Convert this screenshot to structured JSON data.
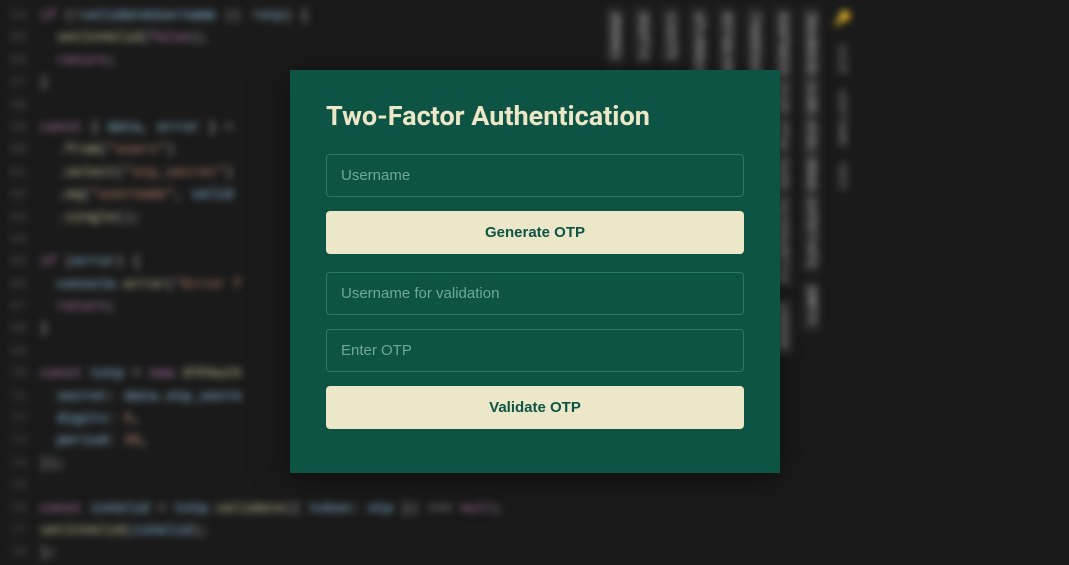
{
  "dialog": {
    "title": "Two-Factor Authentication",
    "username_placeholder": "Username",
    "generate_btn": "Generate OTP",
    "validation_username_placeholder": "Username for validation",
    "otp_placeholder": "Enter OTP",
    "validate_btn": "Validate OTP"
  },
  "code": {
    "lines": [
      {
        "num": "54",
        "text": "if (!validateUsername || !otp) {"
      },
      {
        "num": "55",
        "text": "  setIsValid(false);"
      },
      {
        "num": "56",
        "text": "  return;"
      },
      {
        "num": "57",
        "text": "}"
      },
      {
        "num": "58",
        "text": ""
      },
      {
        "num": "59",
        "text": "const { data, error } = "
      },
      {
        "num": "60",
        "text": "  .from(\"users\")"
      },
      {
        "num": "61",
        "text": "  .select(\"otp_secret\")"
      },
      {
        "num": "62",
        "text": "  .eq(\"username\", valid"
      },
      {
        "num": "63",
        "text": "  .single();"
      },
      {
        "num": "64",
        "text": ""
      },
      {
        "num": "65",
        "text": "if (error) {"
      },
      {
        "num": "66",
        "text": "  console.error(\"Error f"
      },
      {
        "num": "67",
        "text": "  return;"
      },
      {
        "num": "68",
        "text": "}"
      },
      {
        "num": "69",
        "text": ""
      },
      {
        "num": "70",
        "text": "const totp = new OTPAuth"
      },
      {
        "num": "71",
        "text": "  secret: data.otp_secre"
      },
      {
        "num": "72",
        "text": "  digits: 6,"
      },
      {
        "num": "73",
        "text": "  period: 30,"
      },
      {
        "num": "74",
        "text": "});"
      },
      {
        "num": "75",
        "text": ""
      },
      {
        "num": "76",
        "text": "const isValid = totp.validate({ token: otp }) !== null;"
      },
      {
        "num": "77",
        "text": "setIsValid(isValid);"
      },
      {
        "num": "78",
        "text": "};"
      }
    ]
  },
  "data_panel": {
    "header_uuid": "uuid",
    "header_username": "username",
    "header_text": "text",
    "rows": [
      {
        "uuid": "3bedbb3b-2c86-433c-89e6-24f0774f3",
        "username": "EMPTY"
      },
      {
        "uuid": "62bfb62d-21dd-4fae-ba6b-1ec6dedb714",
        "username": "xddddd"
      },
      {
        "uuid": "74ab03ad-7201-40bf-a27d-282b62bd9e63",
        "username": "beno"
      },
      {
        "uuid": "837ebc9b-fd70-444b-8cc2-89dcd07dat",
        "username": "beno"
      },
      {
        "uuid": "afc408e1-d4d1-4344-bf63-e39d8f0236f2",
        "username": "Benowo"
      },
      {
        "uuid": "cce1f5",
        "username": "wo"
      },
      {
        "uuid": "d33f73",
        "username": "gaxdfg"
      },
      {
        "uuid": "d58062",
        "username": "a"
      }
    ]
  }
}
